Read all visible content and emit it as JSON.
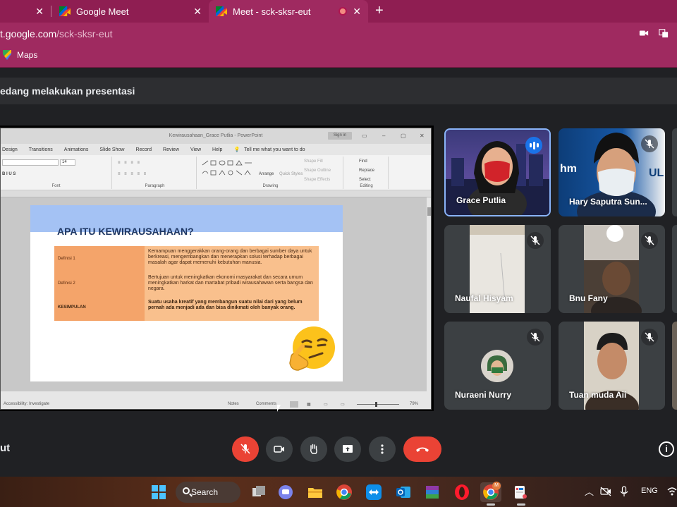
{
  "browser": {
    "tabs": [
      {
        "label": ""
      },
      {
        "label": "Google Meet"
      },
      {
        "label": "Meet - sck-sksr-eut"
      }
    ],
    "new_tab": "+",
    "close_glyph": "✕",
    "url_host": "t.google.com",
    "url_path": "/sck-sksr-eut",
    "bookmarks": [
      {
        "label": "Maps"
      }
    ]
  },
  "banner": {
    "text": "edang melakukan presentasi"
  },
  "powerpoint": {
    "window_title": "Kewirausahaan_Grace Putlia  -  PowerPoint",
    "signin": "Sign in",
    "menu": [
      "Design",
      "Transitions",
      "Animations",
      "Slide Show",
      "Record",
      "Review",
      "View",
      "Help"
    ],
    "tell_me": "Tell me what you want to do",
    "font_size": "14",
    "ribbon_groups": [
      "Font",
      "Paragraph",
      "Drawing",
      "Editing"
    ],
    "ribbon_items": {
      "arrange": "Arrange",
      "quick_styles": "Quick Styles",
      "shape_fill": "Shape Fill",
      "shape_outline": "Shape Outline",
      "shape_effects": "Shape Effects",
      "find": "Find",
      "replace": "Replace",
      "select": "Select"
    },
    "slide": {
      "title": "APA ITU KEWIRAUSAHAAN?",
      "rows": [
        {
          "label": "Definisi 1",
          "text": "Kemampuan menggerakkan orang-orang dan berbagai sumber daya untuk berkreasi, mengembangkan dan menerapkan solusi terhadap berbagai masalah agar dapat memenuhi kebutuhan manusia."
        },
        {
          "label": "Definisi 2",
          "text": "Bertujuan untuk meningkatkan ekonomi masyarakat dan secara umum meningkatkan harkat dan martabat pribadi wirausahawan serta bangsa dan negara."
        },
        {
          "label": "KESIMPULAN",
          "text": "Suatu usaha kreatif yang membangun suatu nilai dari yang belum pernah ada menjadi ada dan bisa dinikmati oleh banyak orang."
        }
      ]
    },
    "status": {
      "accessibility": "Accessibility: Investigate",
      "notes": "Notes",
      "comments": "Comments",
      "zoom": "79%"
    }
  },
  "participants": [
    {
      "name": "Grace Putlia",
      "muted": false
    },
    {
      "name": "Hary Saputra Sun...",
      "muted": true
    },
    {
      "name": "Naufal Hisyam",
      "muted": true
    },
    {
      "name": "Bnu Fany",
      "muted": true
    },
    {
      "name": "Nuraeni Nurry",
      "muted": true
    },
    {
      "name": "Tuan muda Aii",
      "muted": true
    }
  ],
  "meet": {
    "meeting_code": "ut",
    "info_glyph": "i",
    "colors": {
      "end_call": "#ea4335",
      "mic_off": "#ea4335",
      "active_speaker": "#8ab4f8"
    }
  },
  "taskbar": {
    "search_label": "Search",
    "language": "ENG",
    "chrome_badge": "M"
  }
}
